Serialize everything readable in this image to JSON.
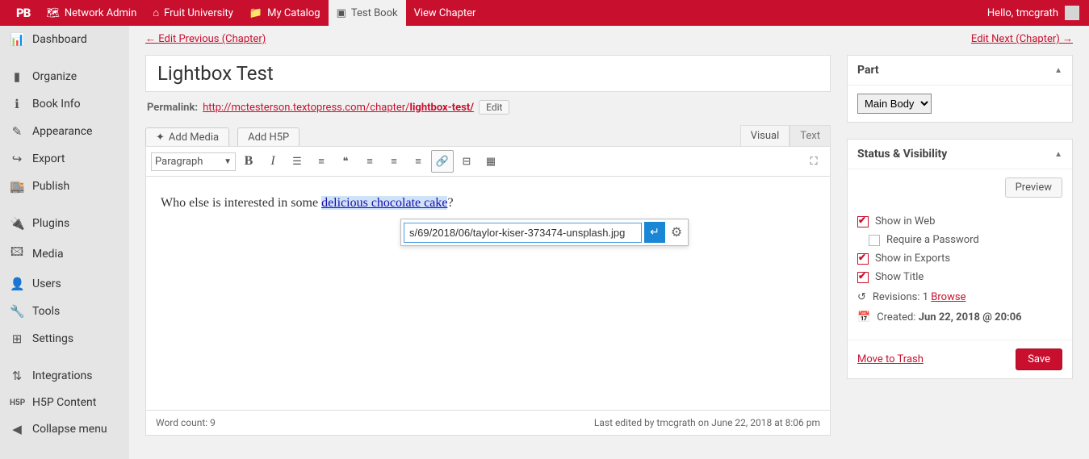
{
  "topbar": {
    "logo": "PB",
    "network": "Network Admin",
    "site": "Fruit University",
    "catalog": "My Catalog",
    "book": "Test Book",
    "view": "View Chapter",
    "greeting": "Hello, tmcgrath"
  },
  "sidebar": {
    "items": [
      {
        "icon": "📊",
        "label": "Dashboard"
      },
      {
        "icon": "▮",
        "label": "Organize"
      },
      {
        "icon": "ℹ",
        "label": "Book Info"
      },
      {
        "icon": "✎",
        "label": "Appearance"
      },
      {
        "icon": "↪",
        "label": "Export"
      },
      {
        "icon": "🏬",
        "label": "Publish"
      },
      {
        "icon": "🔌",
        "label": "Plugins"
      },
      {
        "icon": "🖾",
        "label": "Media"
      },
      {
        "icon": "👤",
        "label": "Users"
      },
      {
        "icon": "🔧",
        "label": "Tools"
      },
      {
        "icon": "⊞",
        "label": "Settings"
      },
      {
        "icon": "⇅",
        "label": "Integrations"
      },
      {
        "icon": "H5P",
        "label": "H5P Content"
      },
      {
        "icon": "◀",
        "label": "Collapse menu"
      }
    ]
  },
  "nav": {
    "prev": "← Edit Previous (Chapter)",
    "next": "Edit Next (Chapter) →"
  },
  "post": {
    "title": "Lightbox Test",
    "permalink_label": "Permalink:",
    "permalink_base": "http://mctesterson.textopress.com/chapter/",
    "permalink_slug": "lightbox-test/",
    "edit_btn": "Edit"
  },
  "media": {
    "add_media": "Add Media",
    "add_h5p": "Add H5P"
  },
  "tabs": {
    "visual": "Visual",
    "text": "Text"
  },
  "toolbar": {
    "format": "Paragraph"
  },
  "content": {
    "before": "Who else is interested in some ",
    "selected": "delicious chocolate cake",
    "after": "?"
  },
  "link_popup": {
    "value": "s/69/2018/06/taylor-kiser-373474-unsplash.jpg"
  },
  "footer": {
    "wordcount": "Word count: 9",
    "lastedit": "Last edited by tmcgrath on June 22, 2018 at 8:06 pm"
  },
  "part_box": {
    "title": "Part",
    "value": "Main Body"
  },
  "status_box": {
    "title": "Status & Visibility",
    "preview": "Preview",
    "show_web": "Show in Web",
    "require_pw": "Require a Password",
    "show_exports": "Show in Exports",
    "show_title": "Show Title",
    "revisions_label": "Revisions:",
    "revisions_count": "1",
    "revisions_browse": "Browse",
    "created_label": "Created:",
    "created_value": "Jun 22, 2018 @ 20:06",
    "trash": "Move to Trash",
    "save": "Save"
  }
}
